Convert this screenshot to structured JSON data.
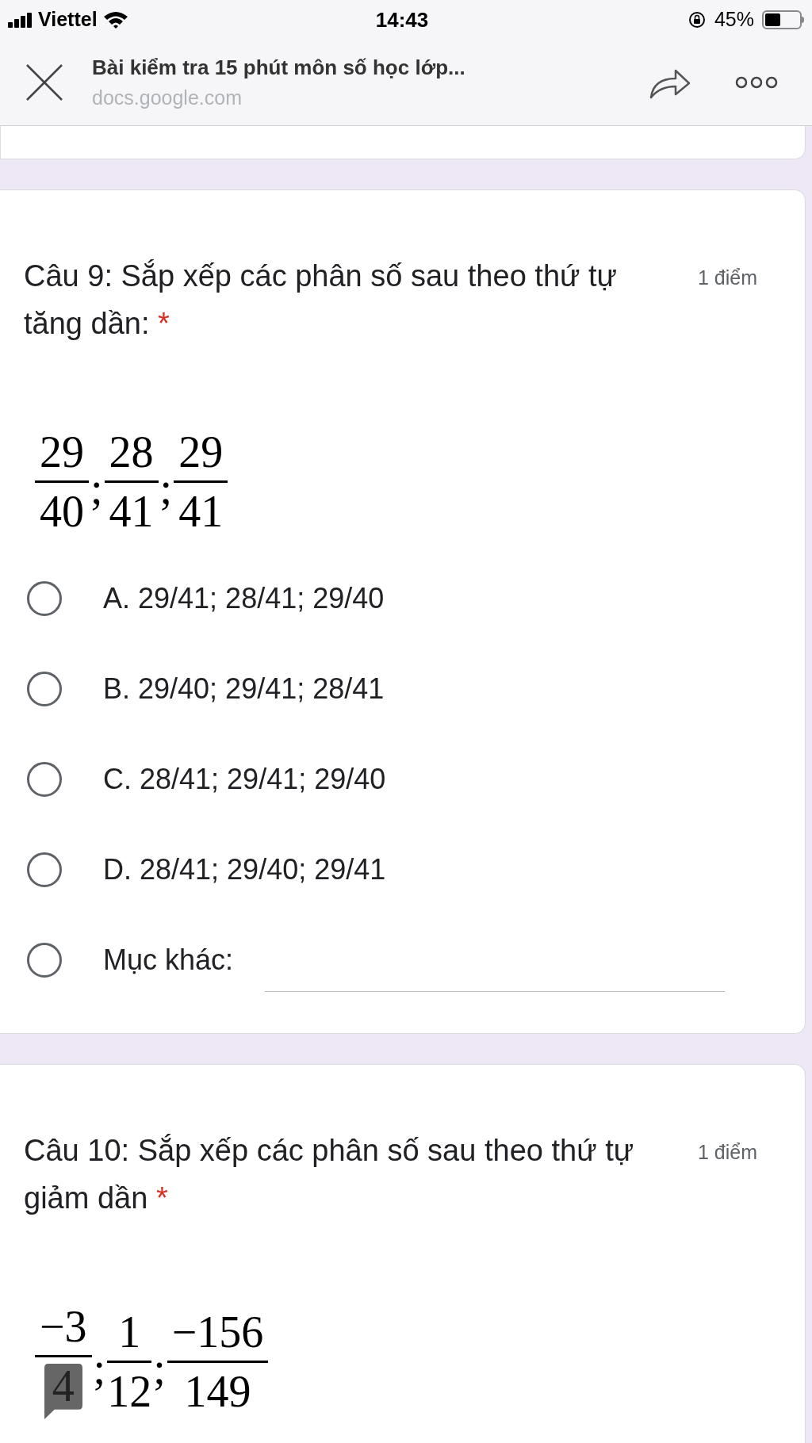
{
  "status_bar": {
    "carrier": "Viettel",
    "time": "14:43",
    "battery": "45%"
  },
  "browser_bar": {
    "title": "Bài kiểm tra 15 phút môn số học lớp...",
    "url": "docs.google.com"
  },
  "questions": [
    {
      "title": "Câu 9: Sắp xếp các phân số sau theo thứ tự tăng dần:",
      "required_mark": "*",
      "points": "1 điểm",
      "fractions": [
        {
          "numerator": "29",
          "denominator": "40",
          "commented": false
        },
        {
          "numerator": "28",
          "denominator": "41",
          "commented": false
        },
        {
          "numerator": "29",
          "denominator": "41",
          "commented": false
        }
      ],
      "separator": ";",
      "options": [
        {
          "label": "A. 29/41; 28/41; 29/40",
          "selected": false
        },
        {
          "label": "B. 29/40; 29/41; 28/41",
          "selected": false
        },
        {
          "label": "C. 28/41; 29/41; 29/40",
          "selected": false
        },
        {
          "label": "D. 28/41; 29/40; 29/41",
          "selected": false
        }
      ],
      "other": {
        "label": "Mục khác:",
        "selected": false
      }
    },
    {
      "title": "Câu 10: Sắp xếp các phân số sau theo thứ tự giảm dần",
      "required_mark": "*",
      "points": "1 điểm",
      "fractions": [
        {
          "numerator": "−3",
          "denominator": "4",
          "commented": true
        },
        {
          "numerator": "1",
          "denominator": "12",
          "commented": false
        },
        {
          "numerator": "−156",
          "denominator": "149",
          "commented": false
        }
      ],
      "separator": ";"
    }
  ]
}
